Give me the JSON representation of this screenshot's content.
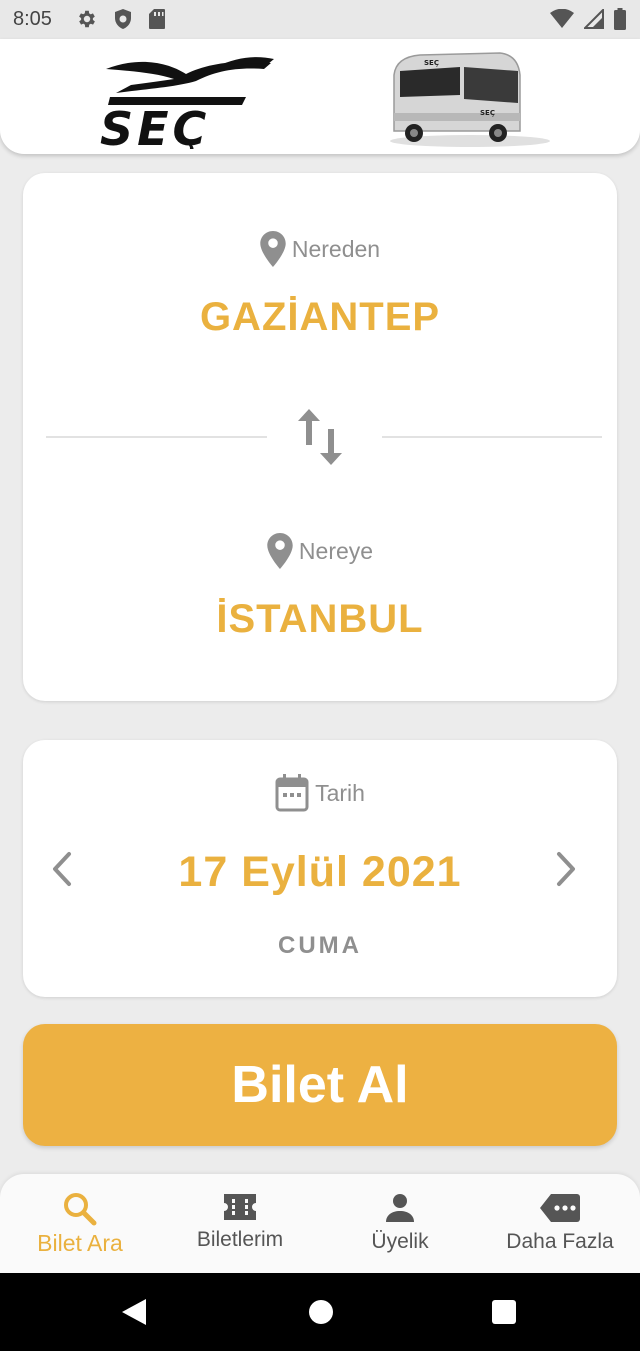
{
  "status_bar": {
    "time": "8:05",
    "left_icons": [
      "gear-icon",
      "shield-icon",
      "sd-card-icon"
    ],
    "right_icons": [
      "wifi-icon",
      "signal-icon",
      "battery-icon"
    ]
  },
  "header": {
    "logo_text": "SEÇ",
    "bus_label": "SEÇ"
  },
  "route": {
    "from_label": "Nereden",
    "from_city": "GAZİANTEP",
    "to_label": "Nereye",
    "to_city": "İSTANBUL",
    "icons": [
      "location-pin-icon",
      "swap-icon"
    ]
  },
  "date": {
    "label": "Tarih",
    "value": "17 Eylül 2021",
    "day": "CUMA",
    "icons": [
      "calendar-icon",
      "chevron-left-icon",
      "chevron-right-icon"
    ]
  },
  "actions": {
    "buy_label": "Bilet Al"
  },
  "bottom_nav": {
    "items": [
      {
        "label": "Bilet Ara",
        "icon": "search-icon",
        "active": true
      },
      {
        "label": "Biletlerim",
        "icon": "ticket-icon",
        "active": false
      },
      {
        "label": "Üyelik",
        "icon": "person-icon",
        "active": false
      },
      {
        "label": "Daha Fazla",
        "icon": "more-label-icon",
        "active": false
      }
    ]
  },
  "colors": {
    "accent": "#EDB142",
    "text_gray": "#8F8F8F",
    "background": "#ECECEC"
  }
}
